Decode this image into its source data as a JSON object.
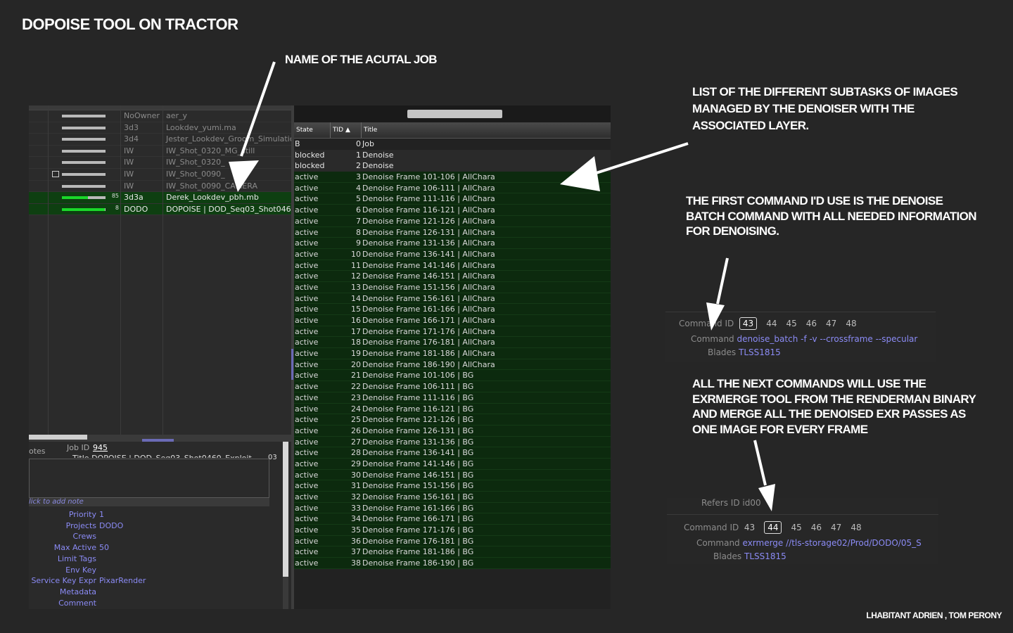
{
  "slide": {
    "title": "DOPOISE TOOL ON TRACTOR",
    "credits": "LHABITANT ADRIEN , TOM PERONY"
  },
  "annotations": {
    "job_name": "NAME OF THE ACUTAL JOB",
    "subtasks": [
      "LIST OF THE DIFFERENT SUBTASKS OF IMAGES",
      "MANAGED BY THE DENOISER WITH THE",
      "ASSOCIATED LAYER."
    ],
    "first_command": [
      "THE FIRST COMMAND I'D USE IS THE DENOISE",
      "BATCH COMMAND WITH ALL NEEDED INFORMATION",
      "FOR DENOISING."
    ],
    "next_commands": [
      "ALL THE NEXT COMMANDS WILL USE THE",
      "EXRMERGE TOOL FROM THE RENDERMAN BINARY",
      "AND MERGE ALL THE DENOISED EXR PASSES AS",
      "ONE IMAGE FOR EVERY FRAME"
    ]
  },
  "jobs": [
    {
      "count": "",
      "owner": "NoOwner",
      "title": "aer_y",
      "active": false,
      "note": false,
      "progress": 1.0
    },
    {
      "count": "",
      "owner": "3d3",
      "title": "Lookdev_yumi.ma",
      "active": false,
      "note": false,
      "progress": 1.0
    },
    {
      "count": "",
      "owner": "3d4",
      "title": "Jester_Lookdev_Groom_Simulatic",
      "active": false,
      "note": false,
      "progress": 1.0
    },
    {
      "count": "",
      "owner": "IW",
      "title": "IW_Shot_0320_MG_still",
      "active": false,
      "note": false,
      "progress": 1.0
    },
    {
      "count": "",
      "owner": "IW",
      "title": "IW_Shot_0320_",
      "active": false,
      "note": false,
      "progress": 1.0
    },
    {
      "count": "",
      "owner": "IW",
      "title": "IW_Shot_0090_",
      "active": false,
      "note": true,
      "progress": 1.0
    },
    {
      "count": "",
      "owner": "IW",
      "title": "IW_Shot_0090_CAMERA",
      "active": false,
      "note": false,
      "progress": 1.0
    },
    {
      "count": "85",
      "owner": "3d3a",
      "title": "Derek_Lookdev_pbh.mb",
      "active": true,
      "note": false,
      "progress": 0.6
    },
    {
      "count": "8",
      "owner": "DODO",
      "title": "DOPOISE | DOD_Seq03_Shot0460",
      "active": true,
      "note": false,
      "progress": 0.98
    }
  ],
  "job_detail": {
    "notes_label": "otes",
    "job_id_label": "Job ID",
    "job_id": "945",
    "title_fragment": "Title  DOPOISE | DOD_Seq03_Shot0460_Exploit",
    "title_end": "03",
    "add_note": "lick to add note",
    "props": [
      {
        "k": "Priority",
        "v": "1"
      },
      {
        "k": "Projects",
        "v": "DODO"
      },
      {
        "k": "Crews",
        "v": ""
      },
      {
        "k": "Max Active",
        "v": "50"
      },
      {
        "k": "Limit Tags",
        "v": ""
      },
      {
        "k": "Env Key",
        "v": ""
      },
      {
        "k": "Service Key Expr",
        "v": "PixarRender"
      },
      {
        "k": "Metadata",
        "v": ""
      },
      {
        "k": "Comment",
        "v": ""
      }
    ]
  },
  "task_header": {
    "state": "State",
    "tid": "TID ▲",
    "title": "Title"
  },
  "tasks": [
    {
      "state": "B",
      "tid": "0",
      "title": "Job"
    },
    {
      "state": "blocked",
      "tid": "1",
      "title": "Denoise"
    },
    {
      "state": "blocked",
      "tid": "2",
      "title": "Denoise"
    },
    {
      "state": "active",
      "tid": "3",
      "title": "Denoise Frame 101-106 | AllChara"
    },
    {
      "state": "active",
      "tid": "4",
      "title": "Denoise Frame 106-111 | AllChara"
    },
    {
      "state": "active",
      "tid": "5",
      "title": "Denoise Frame 111-116 | AllChara"
    },
    {
      "state": "active",
      "tid": "6",
      "title": "Denoise Frame 116-121 | AllChara"
    },
    {
      "state": "active",
      "tid": "7",
      "title": "Denoise Frame 121-126 | AllChara"
    },
    {
      "state": "active",
      "tid": "8",
      "title": "Denoise Frame 126-131 | AllChara"
    },
    {
      "state": "active",
      "tid": "9",
      "title": "Denoise Frame 131-136 | AllChara"
    },
    {
      "state": "active",
      "tid": "10",
      "title": "Denoise Frame 136-141 | AllChara"
    },
    {
      "state": "active",
      "tid": "11",
      "title": "Denoise Frame 141-146 | AllChara"
    },
    {
      "state": "active",
      "tid": "12",
      "title": "Denoise Frame 146-151 | AllChara"
    },
    {
      "state": "active",
      "tid": "13",
      "title": "Denoise Frame 151-156 | AllChara"
    },
    {
      "state": "active",
      "tid": "14",
      "title": "Denoise Frame 156-161 | AllChara"
    },
    {
      "state": "active",
      "tid": "15",
      "title": "Denoise Frame 161-166 | AllChara"
    },
    {
      "state": "active",
      "tid": "16",
      "title": "Denoise Frame 166-171 | AllChara"
    },
    {
      "state": "active",
      "tid": "17",
      "title": "Denoise Frame 171-176 | AllChara"
    },
    {
      "state": "active",
      "tid": "18",
      "title": "Denoise Frame 176-181 | AllChara"
    },
    {
      "state": "active",
      "tid": "19",
      "title": "Denoise Frame 181-186 | AllChara"
    },
    {
      "state": "active",
      "tid": "20",
      "title": "Denoise Frame 186-190 | AllChara"
    },
    {
      "state": "active",
      "tid": "21",
      "title": "Denoise Frame 101-106 | BG"
    },
    {
      "state": "active",
      "tid": "22",
      "title": "Denoise Frame 106-111 | BG"
    },
    {
      "state": "active",
      "tid": "23",
      "title": "Denoise Frame 111-116 | BG"
    },
    {
      "state": "active",
      "tid": "24",
      "title": "Denoise Frame 116-121 | BG"
    },
    {
      "state": "active",
      "tid": "25",
      "title": "Denoise Frame 121-126 | BG"
    },
    {
      "state": "active",
      "tid": "26",
      "title": "Denoise Frame 126-131 | BG"
    },
    {
      "state": "active",
      "tid": "27",
      "title": "Denoise Frame 131-136 | BG"
    },
    {
      "state": "active",
      "tid": "28",
      "title": "Denoise Frame 136-141 | BG"
    },
    {
      "state": "active",
      "tid": "29",
      "title": "Denoise Frame 141-146 | BG"
    },
    {
      "state": "active",
      "tid": "30",
      "title": "Denoise Frame 146-151 | BG"
    },
    {
      "state": "active",
      "tid": "31",
      "title": "Denoise Frame 151-156 | BG"
    },
    {
      "state": "active",
      "tid": "32",
      "title": "Denoise Frame 156-161 | BG"
    },
    {
      "state": "active",
      "tid": "33",
      "title": "Denoise Frame 161-166 | BG"
    },
    {
      "state": "active",
      "tid": "34",
      "title": "Denoise Frame 166-171 | BG"
    },
    {
      "state": "active",
      "tid": "35",
      "title": "Denoise Frame 171-176 | BG"
    },
    {
      "state": "active",
      "tid": "36",
      "title": "Denoise Frame 176-181 | BG"
    },
    {
      "state": "active",
      "tid": "37",
      "title": "Denoise Frame 181-186 | BG"
    },
    {
      "state": "active",
      "tid": "38",
      "title": "Denoise Frame 186-190 | BG"
    }
  ],
  "command_box_1": {
    "id_label": "Command ID",
    "ids": [
      "43",
      "44",
      "45",
      "46",
      "47",
      "48"
    ],
    "selected": "43",
    "command_label": "Command",
    "command": "denoise_batch -f -v --crossframe --specular",
    "blades_label": "Blades",
    "blades": "TLSS1815"
  },
  "command_box_2": {
    "refers_label": "Refers ID",
    "refers_value": "id00",
    "id_label": "Command ID",
    "ids": [
      "43",
      "44",
      "45",
      "46",
      "47",
      "48"
    ],
    "selected": "44",
    "command_label": "Command",
    "command": "exrmerge //tls-storage02/Prod/DODO/05_S",
    "blades_label": "Blades",
    "blades": "TLSS1815"
  },
  "colors": {
    "background": "#262626",
    "active_row": "#0c2a0e",
    "link_blue": "#8b8bf5",
    "progress_green": "#1ad82a"
  }
}
